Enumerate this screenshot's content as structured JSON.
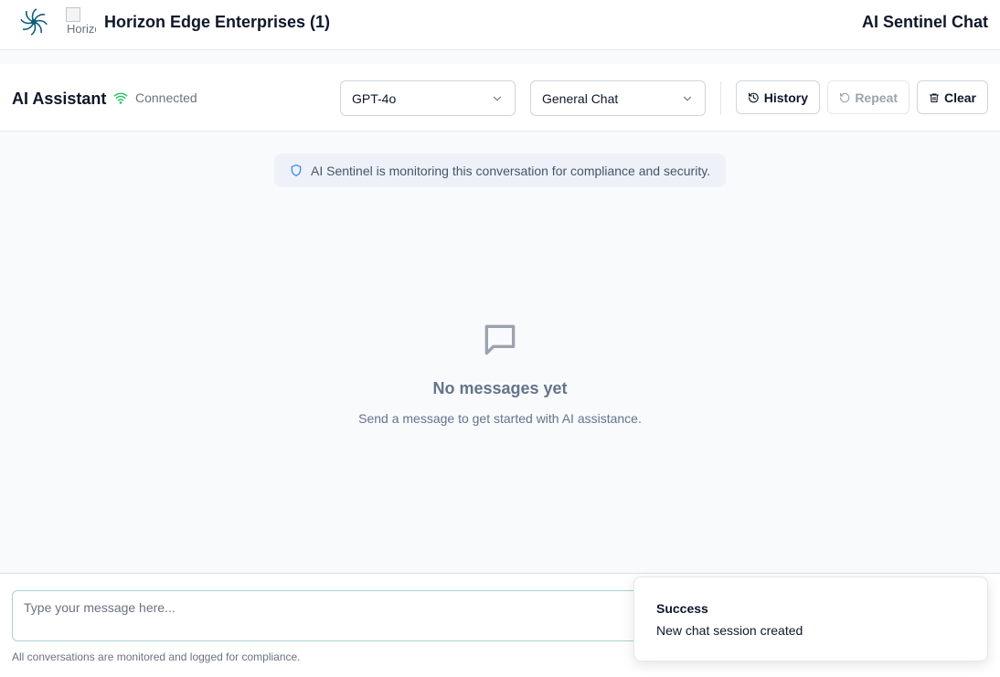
{
  "topbar": {
    "org_name": "Horizon Edge Enterprises (1)",
    "org_logo_alt": "Horizon Edge Enterprises",
    "app_title": "AI Sentinel Chat"
  },
  "chat_header": {
    "title": "AI Assistant",
    "status_text": "Connected",
    "status_color": "#22c55e",
    "model_select": {
      "value": "GPT-4o"
    },
    "mode_select": {
      "value": "General Chat"
    },
    "buttons": {
      "history": "History",
      "repeat": "Repeat",
      "clear": "Clear"
    }
  },
  "notice": {
    "text": "AI Sentinel is monitoring this conversation for compliance and security.",
    "icon": "shield-icon"
  },
  "empty_state": {
    "icon": "message-square-icon",
    "title": "No messages yet",
    "subtitle": "Send a message to get started with AI assistance."
  },
  "composer": {
    "placeholder": "Type your message here...",
    "value": "",
    "footnote": "All conversations are monitored and logged for compliance."
  },
  "toast": {
    "title": "Success",
    "message": "New chat session created"
  },
  "colors": {
    "accent": "#3b82f6",
    "status_ok": "#22c55e",
    "muted_text": "#64748b"
  }
}
